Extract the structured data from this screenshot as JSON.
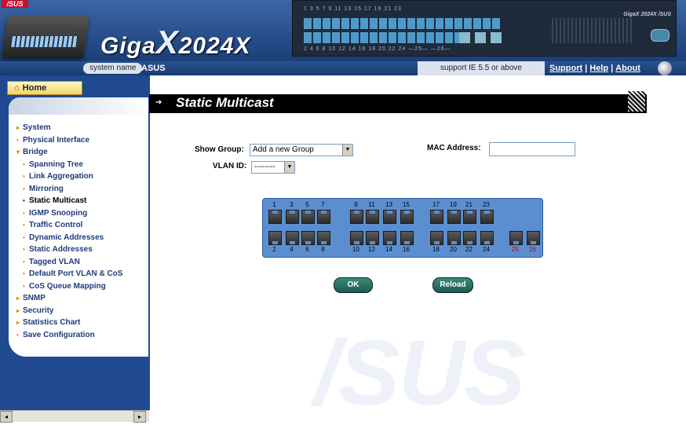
{
  "header": {
    "brand": "/SUS",
    "product_name": "Giga",
    "product_x": "X",
    "product_model": "2024X",
    "front_panel_top_numbers": "1  3  5  7   9  11  13  15   17  19  21  23",
    "front_panel_bottom_numbers": "2  4  6  8   10 12  14  16   18  20  22  24  —25—  —26—",
    "front_panel_brand": "GigaX 2024X /SUS"
  },
  "system_bar": {
    "system_name_label": "system name",
    "system_name_value": "ASUS",
    "browser_note": "support IE 5.5 or above",
    "links": [
      "Support",
      "Help",
      "About"
    ],
    "separator": "|"
  },
  "sidebar": {
    "home_label": "Home",
    "menu": [
      {
        "label": "System",
        "bullet": "▸",
        "level": 0
      },
      {
        "label": "Physical Interface",
        "bullet": "•",
        "level": 0
      },
      {
        "label": "Bridge",
        "bullet": "▾",
        "level": 0
      },
      {
        "label": "Spanning Tree",
        "bullet": "•",
        "level": 1
      },
      {
        "label": "Link Aggregation",
        "bullet": "•",
        "level": 1
      },
      {
        "label": "Mirroring",
        "bullet": "•",
        "level": 1
      },
      {
        "label": "Static Multicast",
        "bullet": "•",
        "level": 1,
        "active": true
      },
      {
        "label": "IGMP Snooping",
        "bullet": "•",
        "level": 1
      },
      {
        "label": "Traffic Control",
        "bullet": "•",
        "level": 1
      },
      {
        "label": "Dynamic Addresses",
        "bullet": "•",
        "level": 1
      },
      {
        "label": "Static Addresses",
        "bullet": "•",
        "level": 1
      },
      {
        "label": "Tagged VLAN",
        "bullet": "•",
        "level": 1
      },
      {
        "label": "Default Port VLAN & CoS",
        "bullet": "•",
        "level": 1
      },
      {
        "label": "CoS Queue Mapping",
        "bullet": "•",
        "level": 1
      },
      {
        "label": "SNMP",
        "bullet": "▸",
        "level": 0
      },
      {
        "label": "Security",
        "bullet": "▸",
        "level": 0
      },
      {
        "label": "Statistics Chart",
        "bullet": "▸",
        "level": 0
      },
      {
        "label": "Save Configuration",
        "bullet": "•",
        "level": 0
      }
    ]
  },
  "main": {
    "title": "Static Multicast",
    "show_group_label": "Show Group:",
    "show_group_value": "Add a new Group",
    "vlan_id_label": "VLAN ID:",
    "vlan_id_value": "--------",
    "mac_label": "MAC Address:",
    "mac_value": "",
    "watermark": "/SUS",
    "ports_top": [
      "1",
      "3",
      "5",
      "7",
      "9",
      "11",
      "13",
      "15",
      "17",
      "19",
      "21",
      "23"
    ],
    "ports_bottom": [
      "2",
      "4",
      "6",
      "8",
      "10",
      "12",
      "14",
      "16",
      "18",
      "20",
      "22",
      "24",
      "25",
      "26"
    ],
    "ports_bottom_colors": {
      "25": "#d00000",
      "26": "#d00000"
    },
    "ok_label": "OK",
    "reload_label": "Reload"
  },
  "scrollbar": {
    "left_arrow": "◂",
    "right_arrow": "▸"
  },
  "colors": {
    "header_blue": "#2a5290",
    "panel_blue": "#5b8ed0",
    "accent_orange": "#e58a00",
    "button_teal": "#2a7565"
  }
}
